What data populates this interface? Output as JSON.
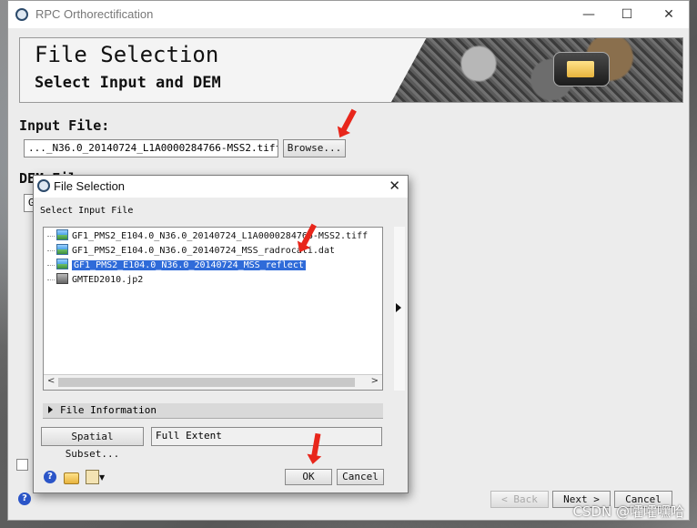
{
  "window": {
    "title": "RPC Orthorectification",
    "controls": {
      "minimize": "—",
      "maximize": "☐",
      "close": "✕"
    }
  },
  "banner": {
    "title": "File Selection",
    "subtitle": "Select Input and DEM"
  },
  "input_file": {
    "label": "Input File:",
    "value": "..._N36.0_20140724_L1A0000284766-MSS2.tiff",
    "browse_label": "Browse..."
  },
  "dem_file": {
    "label": "DEM File",
    "value": "GI"
  },
  "footer": {
    "back_label": "< Back",
    "next_label": "Next >",
    "cancel_label": "Cancel",
    "help": "?"
  },
  "dialog": {
    "title": "File Selection",
    "section_label": "Select Input File",
    "files": [
      {
        "name": "GF1_PMS2_E104.0_N36.0_20140724_L1A0000284766-MSS2.tiff",
        "icon": "raster-image-icon"
      },
      {
        "name": "GF1_PMS2_E104.0_N36.0_20140724_MSS_radrocali.dat",
        "icon": "raster-image-icon"
      },
      {
        "name": "GF1_PMS2_E104.0_N36.0_20140724_MSS_reflect",
        "icon": "raster-image-icon",
        "selected": true
      },
      {
        "name": "GMTED2010.jp2",
        "icon": "dem-image-icon"
      }
    ],
    "file_information_label": "File Information",
    "spatial_subset_label": "Spatial Subset...",
    "spatial_subset_value": "Full Extent",
    "ok_label": "OK",
    "cancel_label": "Cancel",
    "close": "✕"
  },
  "watermark": "CSDN @嚯嚯嘿哈",
  "colors": {
    "selection": "#2f6bd9",
    "annotation_arrow": "#e8261b",
    "help_icon": "#2b55c8"
  }
}
